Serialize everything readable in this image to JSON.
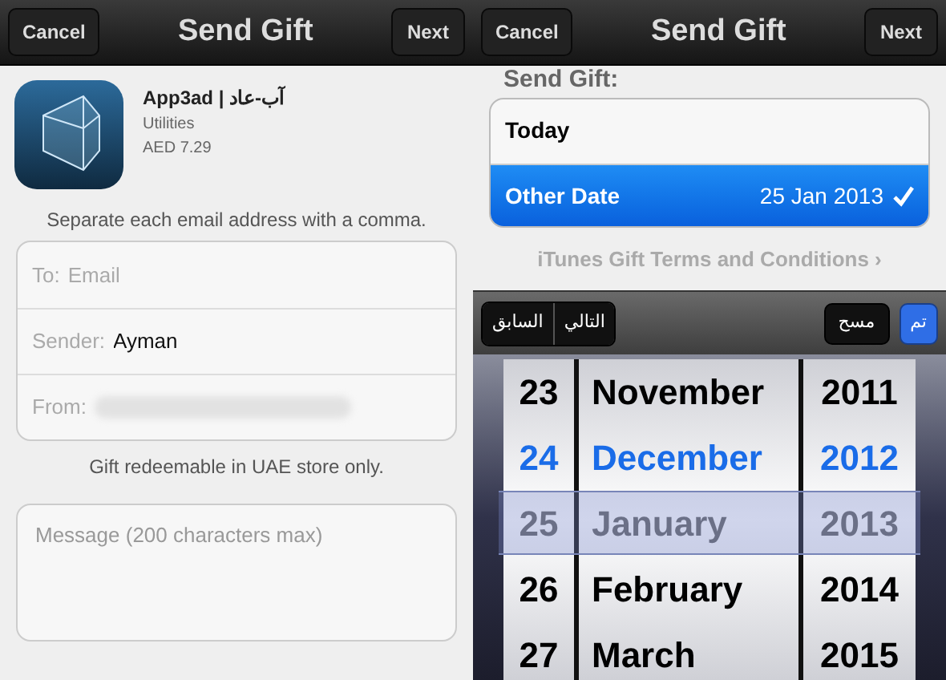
{
  "left": {
    "nav": {
      "cancel": "Cancel",
      "title": "Send Gift",
      "next": "Next"
    },
    "app": {
      "name": "App3ad | آب-عاد",
      "category": "Utilities",
      "price": "AED 7.29"
    },
    "hint": "Separate each email address with a comma.",
    "fields": [
      {
        "label": "To:",
        "placeholder": "Email",
        "redacted": false
      },
      {
        "label": "Sender:",
        "value": "Ayman",
        "redacted": false
      },
      {
        "label": "From:",
        "redacted": true
      }
    ],
    "note": "Gift redeemable in UAE store only.",
    "message": {
      "placeholder": "Message (200 characters max)"
    }
  },
  "right": {
    "nav": {
      "cancel": "Cancel",
      "title": "Send Gift",
      "next": "Next"
    },
    "section": "Send Gift:",
    "options": [
      {
        "label": "Today",
        "selected": false
      },
      {
        "label": "Other Date",
        "detail": "25 Jan 2013",
        "selected": true
      }
    ],
    "terms": "iTunes Gift Terms and Conditions ›",
    "toolbar": {
      "previous": "السابق",
      "next": "التالي",
      "clear": "مسح",
      "done": "تم"
    },
    "picker": [
      {
        "day": "23",
        "month": "November",
        "year": "2011",
        "selected": false,
        "today": false
      },
      {
        "day": "24",
        "month": "December",
        "year": "2012",
        "selected": false,
        "today": true
      },
      {
        "day": "25",
        "month": "January",
        "year": "2013",
        "selected": true,
        "today": false
      },
      {
        "day": "26",
        "month": "February",
        "year": "2014",
        "selected": false,
        "today": false
      },
      {
        "day": "27",
        "month": "March",
        "year": "2015",
        "selected": false,
        "today": false
      }
    ]
  }
}
